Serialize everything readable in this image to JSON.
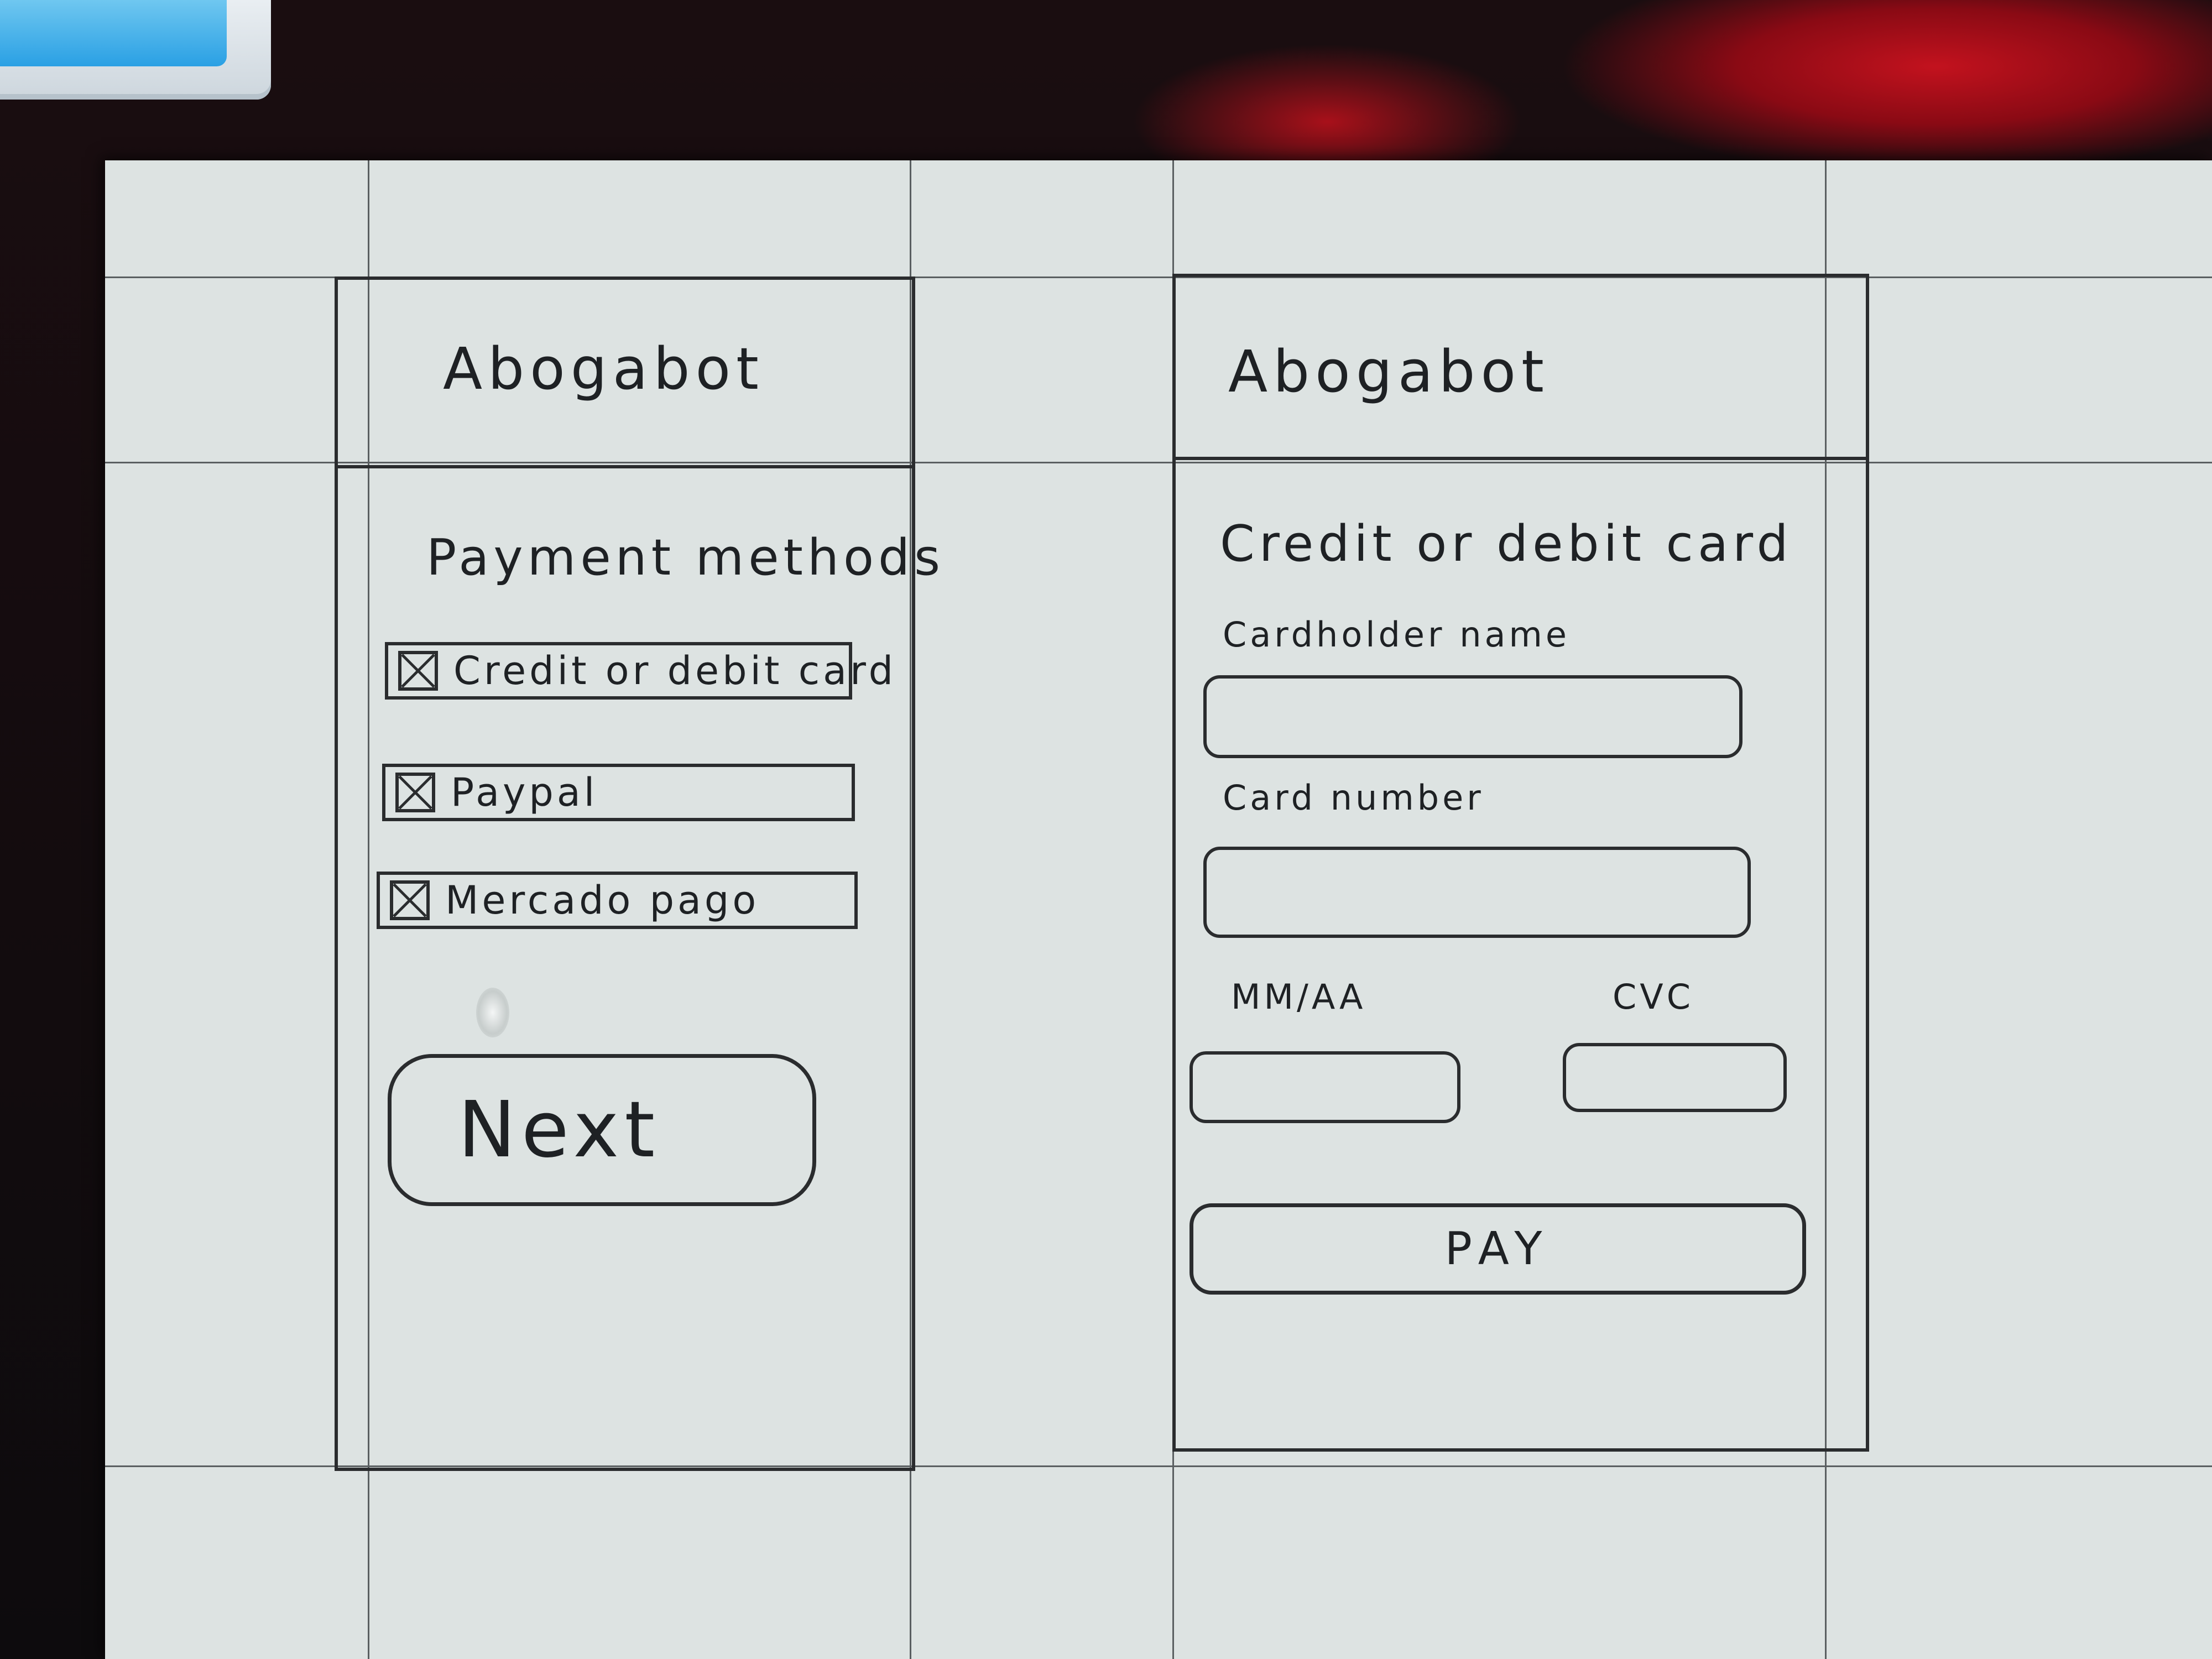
{
  "screens": [
    {
      "app_title": "Abogabot",
      "section_title": "Payment methods",
      "options": [
        {
          "label": "Credit or debit card",
          "checked": true
        },
        {
          "label": "Paypal",
          "checked": true
        },
        {
          "label": "Mercado pago",
          "checked": true
        }
      ],
      "primary_button": "Next"
    },
    {
      "app_title": "Abogabot",
      "section_title": "Credit or debit card",
      "fields": {
        "cardholder_label": "Cardholder name",
        "card_number_label": "Card number",
        "expiry_label": "MM/AA",
        "cvc_label": "CVC"
      },
      "primary_button": "PAY"
    }
  ]
}
